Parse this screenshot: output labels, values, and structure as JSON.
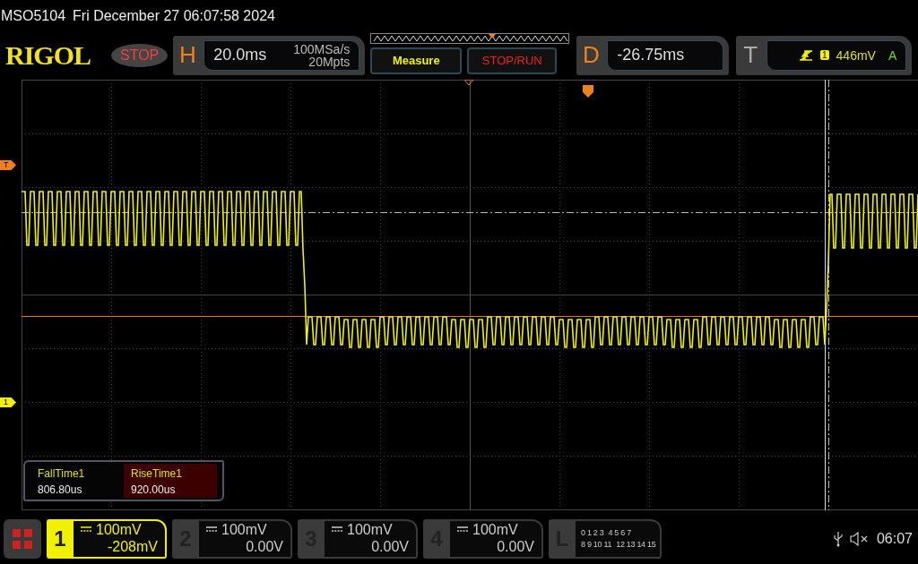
{
  "title": {
    "model": "MSO5104",
    "datetime": "Fri December 27 06:07:58 2024"
  },
  "logo": "RIGOL",
  "run_state": "STOP",
  "horizontal": {
    "label": "H",
    "scale": "20.0ms",
    "sample_rate": "100MSa/s",
    "memory": "20Mpts"
  },
  "buttons": [
    {
      "label": "Measure",
      "kind": "menu"
    },
    {
      "label": "STOP/RUN",
      "kind": "stop"
    }
  ],
  "delay": {
    "label": "D",
    "value": "-26.75ms"
  },
  "trigger": {
    "label": "T",
    "source": "1",
    "level": "446mV",
    "mode": "A"
  },
  "markers": [
    {
      "label": "T",
      "kind": "trigger"
    },
    {
      "label": "1",
      "kind": "channel"
    }
  ],
  "measurements": [
    {
      "name": "FallTime1",
      "value": "806.80us",
      "selected": false
    },
    {
      "name": "RiseTime1",
      "value": "920.00us",
      "selected": true
    }
  ],
  "channels": [
    {
      "number": "1",
      "scale": "100mV",
      "offset": "-208mV",
      "active": true
    },
    {
      "number": "2",
      "scale": "100mV",
      "offset": "0.00V",
      "active": false
    },
    {
      "number": "3",
      "scale": "100mV",
      "offset": "0.00V",
      "active": false
    },
    {
      "number": "4",
      "scale": "100mV",
      "offset": "0.00V",
      "active": false
    }
  ],
  "logic": {
    "label": "L",
    "rows": [
      [
        "0 1 2 3",
        "4 5 6 7"
      ],
      [
        "8 9 10 11",
        "12 13 14 15"
      ]
    ]
  },
  "status": {
    "time": "06:07"
  }
}
